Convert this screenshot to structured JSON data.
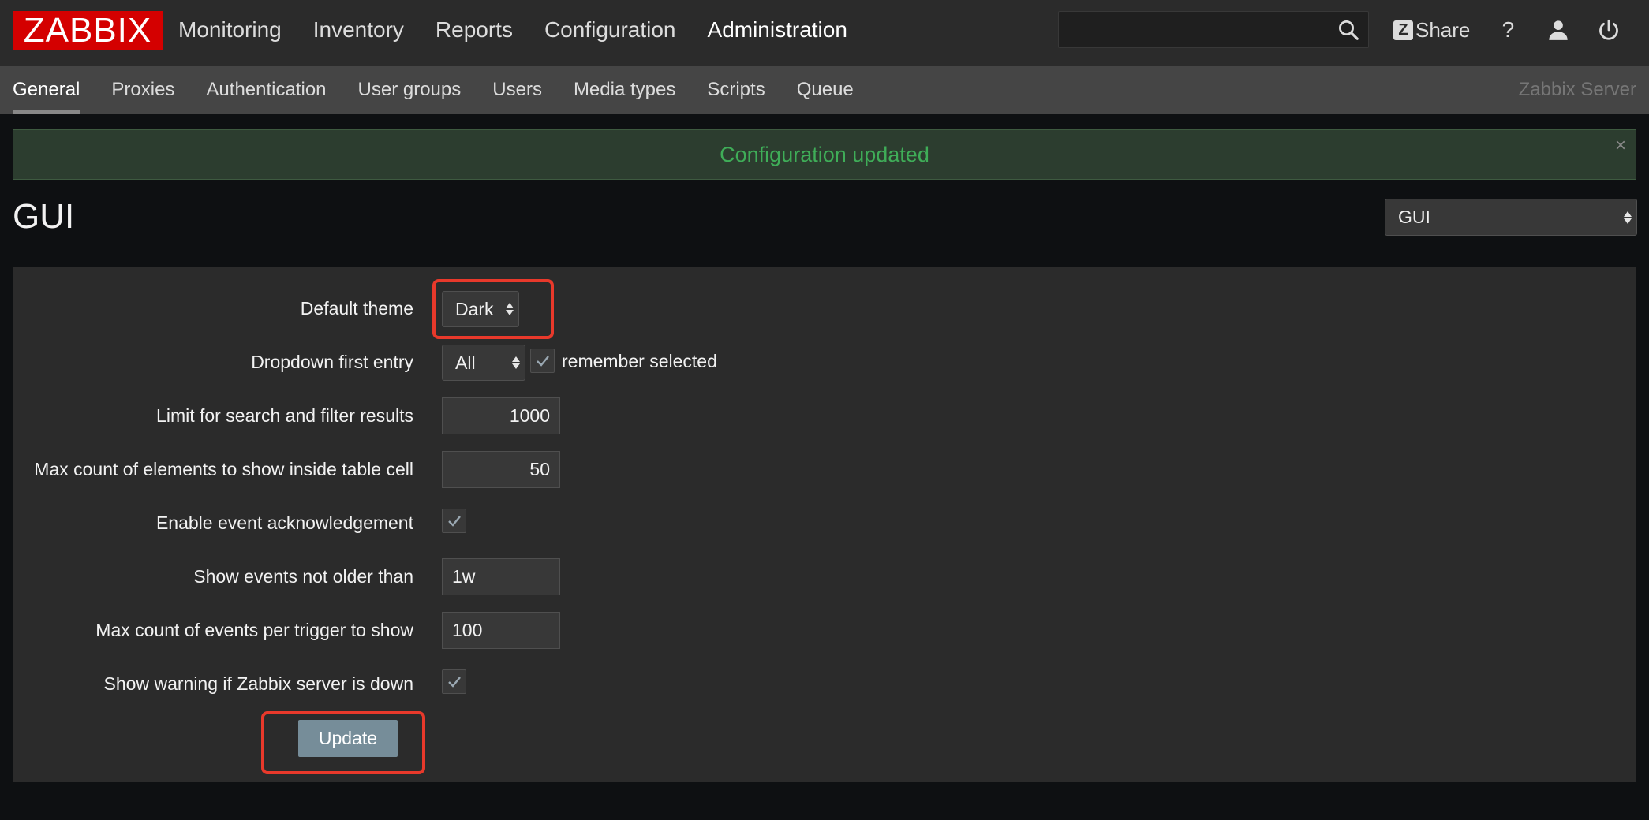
{
  "header": {
    "logo_text": "ZABBIX",
    "main_nav": [
      "Monitoring",
      "Inventory",
      "Reports",
      "Configuration",
      "Administration"
    ],
    "active_main": "Administration",
    "search_value": "",
    "share_label": "Share",
    "share_badge": "Z",
    "help_glyph": "?"
  },
  "subnav": {
    "items": [
      "General",
      "Proxies",
      "Authentication",
      "User groups",
      "Users",
      "Media types",
      "Scripts",
      "Queue"
    ],
    "active": "General",
    "server_name": "Zabbix Server"
  },
  "message": {
    "text": "Configuration updated",
    "close_glyph": "×",
    "color": "#3fad58"
  },
  "page": {
    "title": "GUI",
    "section_select": "GUI"
  },
  "form": {
    "default_theme": {
      "label": "Default theme",
      "value": "Dark"
    },
    "dropdown_first_entry": {
      "label": "Dropdown first entry",
      "value": "All",
      "remember_label": "remember selected",
      "remember_checked": true
    },
    "search_limit": {
      "label": "Limit for search and filter results",
      "value": "1000"
    },
    "max_table_cell": {
      "label": "Max count of elements to show inside table cell",
      "value": "50"
    },
    "event_ack": {
      "label": "Enable event acknowledgement",
      "checked": true
    },
    "events_not_older": {
      "label": "Show events not older than",
      "value": "1w"
    },
    "max_events_per_trigger": {
      "label": "Max count of events per trigger to show",
      "value": "100"
    },
    "server_down_warning": {
      "label": "Show warning if Zabbix server is down",
      "checked": true
    },
    "update_button": "Update"
  },
  "colors": {
    "brand": "#d40000",
    "highlight": "#e8392b",
    "button": "#768d99"
  }
}
